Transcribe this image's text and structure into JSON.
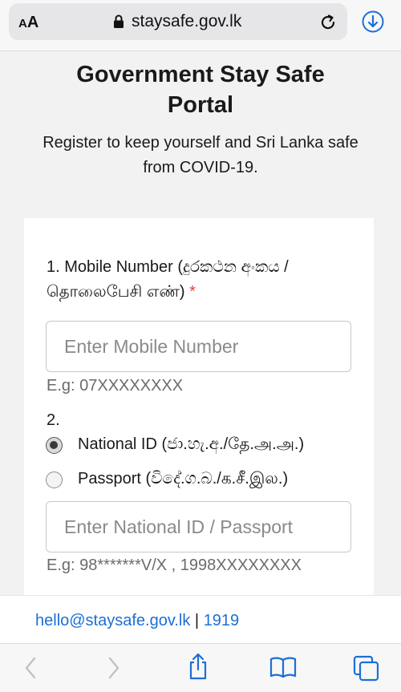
{
  "browser": {
    "aa_label_large": "A",
    "aa_label_small": "A",
    "url": "staysafe.gov.lk",
    "icons": [
      "lock-icon",
      "reload-icon",
      "download-icon",
      "back-icon",
      "forward-icon",
      "share-icon",
      "bookmarks-icon",
      "tabs-icon"
    ]
  },
  "page": {
    "title": "Government Stay Safe Portal",
    "subtitle": "Register to keep yourself and Sri Lanka safe from COVID-19."
  },
  "form": {
    "mobile": {
      "label": "1. Mobile Number (දුරකථන අංකය / தொலைபேசி எண்)",
      "required_mark": "*",
      "placeholder": "Enter Mobile Number",
      "hint": "E.g: 07XXXXXXXX"
    },
    "id_section": {
      "number": "2.",
      "options": [
        {
          "label": "National ID (ජා.හැ.අ./தே.அ.அ.)",
          "checked": true
        },
        {
          "label": "Passport (විදේ.ග.බ./க.சீ.இல.)",
          "checked": false
        }
      ],
      "placeholder": "Enter National ID / Passport",
      "hint": "E.g: 98*******V/X , 1998XXXXXXXX"
    }
  },
  "footer": {
    "email": "hello@staysafe.gov.lk",
    "separator": "|",
    "phone": "1919"
  },
  "colors": {
    "accent": "#1c6fd6",
    "required": "#e0433b"
  }
}
